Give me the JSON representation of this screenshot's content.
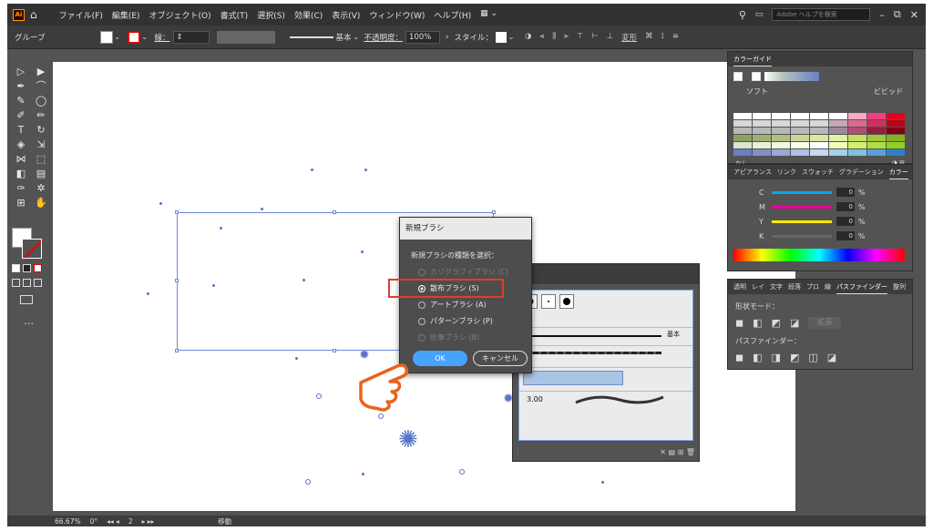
{
  "app": {
    "logo": "Ai",
    "home_icon": "home-icon"
  },
  "menu": {
    "items": [
      "ファイル(F)",
      "編集(E)",
      "オブジェクト(O)",
      "書式(T)",
      "選択(S)",
      "効果(C)",
      "表示(V)",
      "ウィンドウ(W)",
      "ヘルプ(H)"
    ],
    "search_placeholder": "Adobe ヘルプを検索"
  },
  "controlbar": {
    "selection_label": "グループ",
    "stroke_label": "線：",
    "brush_label": "基本",
    "opacity_label": "不透明度：",
    "opacity_value": "100%",
    "style_label": "スタイル：",
    "transform_label": "変形"
  },
  "tools": {
    "icons": [
      "selection-tool-icon",
      "direct-selection-tool-icon",
      "pen-tool-icon",
      "curvature-tool-icon",
      "paintbrush-tool-icon",
      "ellipse-tool-icon",
      "shaper-tool-icon",
      "pencil-tool-icon",
      "type-tool-icon",
      "rotate-tool-icon",
      "eraser-tool-icon",
      "scale-tool-icon",
      "width-tool-icon",
      "free-transform-tool-icon",
      "shape-builder-tool-icon",
      "gradient-tool-icon",
      "eyedropper-tool-icon",
      "symbol-sprayer-tool-icon",
      "artboard-tool-icon",
      "hand-tool-icon"
    ],
    "glyphs": [
      "▷",
      "▶",
      "✒",
      "⌒",
      "✎",
      "◯",
      "✐",
      "✏",
      "T",
      "↻",
      "◈",
      "⇲",
      "⋈",
      "⬚",
      "◧",
      "▤",
      "✑",
      "✲",
      "⊞",
      "✋"
    ],
    "more": "…"
  },
  "dialog": {
    "title": "新規ブラシ",
    "prompt": "新規ブラシの種類を選択：",
    "options": [
      {
        "label": "カリグラフィブラシ (C)",
        "enabled": false,
        "selected": false
      },
      {
        "label": "散布ブラシ (S)",
        "enabled": true,
        "selected": true
      },
      {
        "label": "アートブラシ (A)",
        "enabled": true,
        "selected": false
      },
      {
        "label": "パターンブラシ (P)",
        "enabled": true,
        "selected": false
      },
      {
        "label": "絵筆ブラシ (B)",
        "enabled": false,
        "selected": false
      }
    ],
    "ok": "OK",
    "cancel": "キャンセル"
  },
  "brush_panel": {
    "basic_label": "基本",
    "size_value": "3.00"
  },
  "color_guide": {
    "tab": "カラーガイド",
    "soft": "ソフト",
    "vivid": "ビビッド",
    "none": "なし",
    "swatch_colors": [
      [
        "#ffffff",
        "#ffffff",
        "#ffffff",
        "#ffffff",
        "#ffffff",
        "#ffffff",
        "#f8a8c8",
        "#f04080",
        "#e8001c"
      ],
      [
        "#d8d8d8",
        "#d8d8d8",
        "#d8d8d8",
        "#d8d8d8",
        "#d8d8d8",
        "#c8a8b8",
        "#e06890",
        "#d0305c",
        "#c00014"
      ],
      [
        "#b8b8b8",
        "#b8b8b8",
        "#b8b8b8",
        "#b8b8b8",
        "#b8b8b8",
        "#a08898",
        "#b05070",
        "#902040",
        "#800010"
      ],
      [
        "#90a060",
        "#a0b070",
        "#b0c080",
        "#c8d890",
        "#d8e8a0",
        "#e0f0a8",
        "#c8e060",
        "#a0c838",
        "#88b020"
      ],
      [
        "#d8e8d0",
        "#e8f0d8",
        "#f0f8e0",
        "#f8ffe8",
        "#ffffff",
        "#f0ffb8",
        "#d0f070",
        "#b0e040",
        "#90d020"
      ],
      [
        "#6a7fc0",
        "#8090c8",
        "#98a8d8",
        "#b0c0e8",
        "#c8d8f0",
        "#a8d0e8",
        "#80c0e0",
        "#58a0d8",
        "#3080c8"
      ]
    ]
  },
  "color_panel": {
    "tabs": [
      "アピアランス",
      "リンク",
      "スウォッチ",
      "グラデーション",
      "カラー"
    ],
    "channels": [
      {
        "name": "C",
        "value": "0",
        "color": "#00a8e8"
      },
      {
        "name": "M",
        "value": "0",
        "color": "#e8009c"
      },
      {
        "name": "Y",
        "value": "0",
        "color": "#ffe800"
      },
      {
        "name": "K",
        "value": "0",
        "color": "#666666"
      }
    ],
    "unit": "%"
  },
  "pathfinder": {
    "tabs": [
      "透明",
      "レイ",
      "文字",
      "段落",
      "プロ",
      "線",
      "パスファインダー",
      "整列"
    ],
    "shape_modes": "形状モード：",
    "expand": "拡張",
    "pathfinders": "パスファインダー："
  },
  "status": {
    "zoom": "66.67%",
    "rotation": "0°",
    "artboard": "2",
    "mode": "移動"
  }
}
